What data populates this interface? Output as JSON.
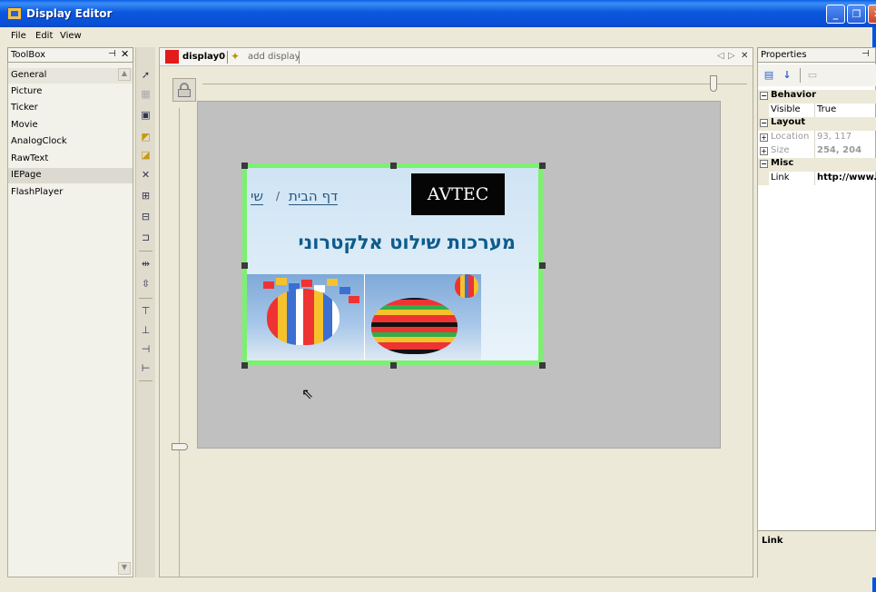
{
  "window": {
    "title": "Display Editor"
  },
  "menu": [
    "File",
    "Edit",
    "View"
  ],
  "toolbox": {
    "title": "ToolBox",
    "items": [
      "General",
      "Picture",
      "Ticker",
      "Movie",
      "AnalogClock",
      "RawText",
      "IEPage",
      "FlashPlayer"
    ],
    "selected": "IEPage"
  },
  "tabs": {
    "active": "display0",
    "add": "add display"
  },
  "page": {
    "logo": "AVTEC",
    "crumb_home": "דף הבית",
    "crumb_sep": "/",
    "crumb_partial": "שי",
    "headline": "מערכות שילוט אלקטרוני"
  },
  "properties": {
    "title": "Properties",
    "categories": [
      {
        "name": "Behavior",
        "rows": [
          {
            "name": "Visible",
            "value": "True"
          }
        ]
      },
      {
        "name": "Layout",
        "rows": [
          {
            "name": "Location",
            "value": "93, 117"
          },
          {
            "name": "Size",
            "value": "254, 204"
          }
        ]
      },
      {
        "name": "Misc",
        "rows": [
          {
            "name": "Link",
            "value": "http://www."
          }
        ]
      }
    ],
    "description": "Link"
  },
  "colors": {
    "selection": "#7cf070",
    "tab_swatch": "#e31b1b",
    "titlebar": "#0a58dd"
  }
}
